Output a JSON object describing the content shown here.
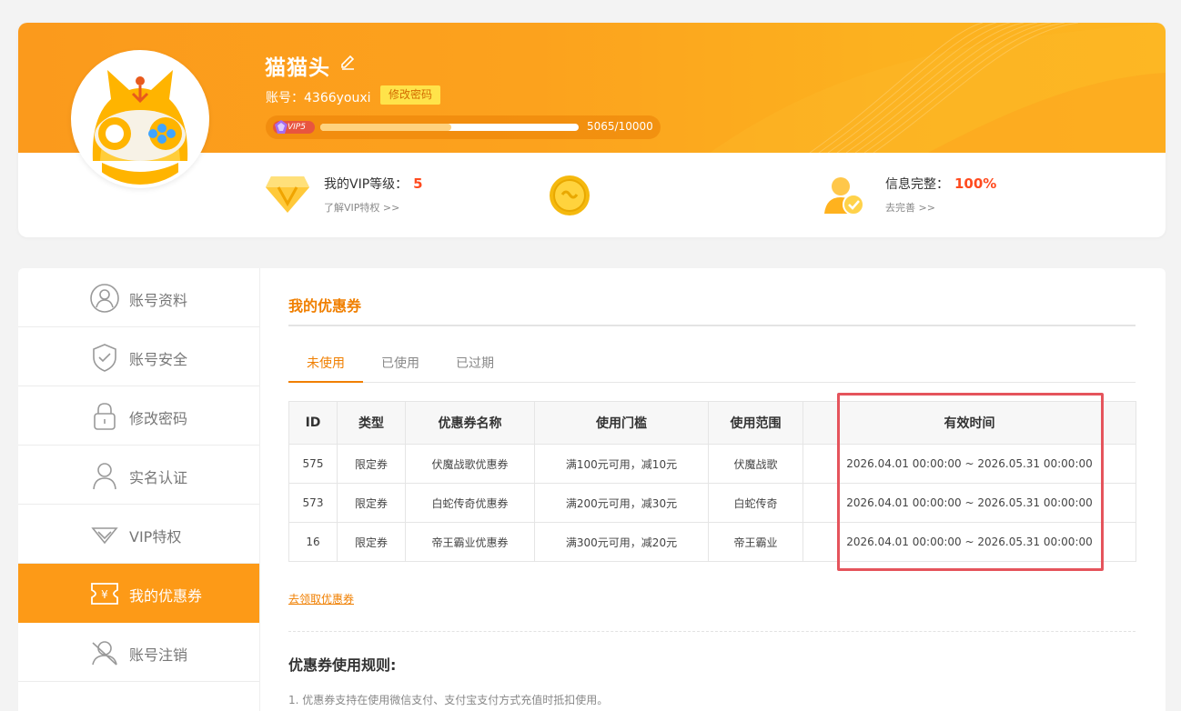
{
  "profile": {
    "nickname": "猫猫头",
    "account_text": "账号：4366youxi",
    "change_password": "修改密码",
    "vip_badge": "VIP5",
    "vip_progress_text": "5065/10000",
    "vip_progress": 0.5065
  },
  "stats": {
    "vip_level_label": "我的VIP等级：",
    "vip_level_value": "5",
    "vip_link": "了解VIP特权 >>",
    "info_label": "信息完整：",
    "info_value": "100%",
    "info_link": "去完善 >>"
  },
  "sidebar": {
    "items": [
      {
        "label": "账号资料",
        "icon": "user-circle-icon"
      },
      {
        "label": "账号安全",
        "icon": "shield-check-icon"
      },
      {
        "label": "修改密码",
        "icon": "lock-icon"
      },
      {
        "label": "实名认证",
        "icon": "person-icon"
      },
      {
        "label": "VIP特权",
        "icon": "vip-diamond-icon"
      },
      {
        "label": "我的优惠券",
        "icon": "coupon-icon"
      },
      {
        "label": "账号注销",
        "icon": "user-cancel-icon"
      }
    ],
    "active_index": 5
  },
  "content": {
    "title": "我的优惠券",
    "tabs": [
      "未使用",
      "已使用",
      "已过期"
    ],
    "active_tab": 0,
    "table": {
      "headers": [
        "ID",
        "类型",
        "优惠券名称",
        "使用门槛",
        "使用范围",
        "有效时间"
      ],
      "rows": [
        [
          "575",
          "限定券",
          "伏魔战歌优惠券",
          "满100元可用，减10元",
          "伏魔战歌",
          "2026.04.01 00:00:00 ~ 2026.05.31 00:00:00"
        ],
        [
          "573",
          "限定券",
          "白蛇传奇优惠券",
          "满200元可用，减30元",
          "白蛇传奇",
          "2026.04.01 00:00:00 ~ 2026.05.31 00:00:00"
        ],
        [
          "16",
          "限定券",
          "帝王霸业优惠券",
          "满300元可用，减20元",
          "帝王霸业",
          "2026.04.01 00:00:00 ~ 2026.05.31 00:00:00"
        ]
      ]
    },
    "get_coupon_link": "去领取优惠券",
    "rules_title": "优惠券使用规则:",
    "rule_1": "1. 优惠券支持在使用微信支付、支付宝支付方式充值时抵扣使用。"
  },
  "colors": {
    "brand_orange": "#fd9a17",
    "accent_orange": "#f07f00",
    "highlight_red": "#e5545c"
  }
}
